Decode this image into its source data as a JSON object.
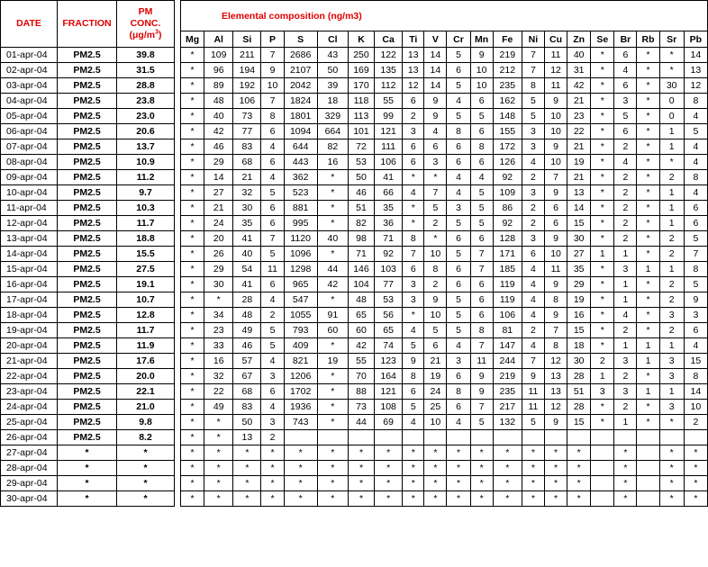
{
  "left_headers": {
    "date": "DATE",
    "fraction": "FRACTION",
    "pm_line1": "PM",
    "pm_line2": "CONC.",
    "pm_unit_pre": "(μg/m",
    "pm_unit_sup": "3",
    "pm_unit_post": ")"
  },
  "right_title": "Elemental composition (ng/m3)",
  "elements": [
    "Mg",
    "Al",
    "Si",
    "P",
    "S",
    "Cl",
    "K",
    "Ca",
    "Ti",
    "V",
    "Cr",
    "Mn",
    "Fe",
    "Ni",
    "Cu",
    "Zn",
    "Se",
    "Br",
    "Rb",
    "Sr",
    "Pb"
  ],
  "rows": [
    {
      "date": "01-apr-04",
      "fraction": "PM2.5",
      "conc": "39.8",
      "vals": [
        "*",
        "109",
        "211",
        "7",
        "2686",
        "43",
        "250",
        "122",
        "13",
        "14",
        "5",
        "9",
        "219",
        "7",
        "11",
        "40",
        "*",
        "6",
        "*",
        "*",
        "14"
      ]
    },
    {
      "date": "02-apr-04",
      "fraction": "PM2.5",
      "conc": "31.5",
      "vals": [
        "*",
        "96",
        "194",
        "9",
        "2107",
        "50",
        "169",
        "135",
        "13",
        "14",
        "6",
        "10",
        "212",
        "7",
        "12",
        "31",
        "*",
        "4",
        "*",
        "*",
        "13"
      ]
    },
    {
      "date": "03-apr-04",
      "fraction": "PM2.5",
      "conc": "28.8",
      "vals": [
        "*",
        "89",
        "192",
        "10",
        "2042",
        "39",
        "170",
        "112",
        "12",
        "14",
        "5",
        "10",
        "235",
        "8",
        "11",
        "42",
        "*",
        "6",
        "*",
        "30",
        "12"
      ]
    },
    {
      "date": "04-apr-04",
      "fraction": "PM2.5",
      "conc": "23.8",
      "vals": [
        "*",
        "48",
        "106",
        "7",
        "1824",
        "18",
        "118",
        "55",
        "6",
        "9",
        "4",
        "6",
        "162",
        "5",
        "9",
        "21",
        "*",
        "3",
        "*",
        "0",
        "8"
      ]
    },
    {
      "date": "05-apr-04",
      "fraction": "PM2.5",
      "conc": "23.0",
      "vals": [
        "*",
        "40",
        "73",
        "8",
        "1801",
        "329",
        "113",
        "99",
        "2",
        "9",
        "5",
        "5",
        "148",
        "5",
        "10",
        "23",
        "*",
        "5",
        "*",
        "0",
        "4"
      ]
    },
    {
      "date": "06-apr-04",
      "fraction": "PM2.5",
      "conc": "20.6",
      "vals": [
        "*",
        "42",
        "77",
        "6",
        "1094",
        "664",
        "101",
        "121",
        "3",
        "4",
        "8",
        "6",
        "155",
        "3",
        "10",
        "22",
        "*",
        "6",
        "*",
        "1",
        "5"
      ]
    },
    {
      "date": "07-apr-04",
      "fraction": "PM2.5",
      "conc": "13.7",
      "vals": [
        "*",
        "46",
        "83",
        "4",
        "644",
        "82",
        "72",
        "111",
        "6",
        "6",
        "6",
        "8",
        "172",
        "3",
        "9",
        "21",
        "*",
        "2",
        "*",
        "1",
        "4"
      ]
    },
    {
      "date": "08-apr-04",
      "fraction": "PM2.5",
      "conc": "10.9",
      "vals": [
        "*",
        "29",
        "68",
        "6",
        "443",
        "16",
        "53",
        "106",
        "6",
        "3",
        "6",
        "6",
        "126",
        "4",
        "10",
        "19",
        "*",
        "4",
        "*",
        "*",
        "4"
      ]
    },
    {
      "date": "09-apr-04",
      "fraction": "PM2.5",
      "conc": "11.2",
      "vals": [
        "*",
        "14",
        "21",
        "4",
        "362",
        "*",
        "50",
        "41",
        "*",
        "*",
        "4",
        "4",
        "92",
        "2",
        "7",
        "21",
        "*",
        "2",
        "*",
        "2",
        "8"
      ]
    },
    {
      "date": "10-apr-04",
      "fraction": "PM2.5",
      "conc": "9.7",
      "vals": [
        "*",
        "27",
        "32",
        "5",
        "523",
        "*",
        "46",
        "66",
        "4",
        "7",
        "4",
        "5",
        "109",
        "3",
        "9",
        "13",
        "*",
        "2",
        "*",
        "1",
        "4"
      ]
    },
    {
      "date": "11-apr-04",
      "fraction": "PM2.5",
      "conc": "10.3",
      "vals": [
        "*",
        "21",
        "30",
        "6",
        "881",
        "*",
        "51",
        "35",
        "*",
        "5",
        "3",
        "5",
        "86",
        "2",
        "6",
        "14",
        "*",
        "2",
        "*",
        "1",
        "6"
      ]
    },
    {
      "date": "12-apr-04",
      "fraction": "PM2.5",
      "conc": "11.7",
      "vals": [
        "*",
        "24",
        "35",
        "6",
        "995",
        "*",
        "82",
        "36",
        "*",
        "2",
        "5",
        "5",
        "92",
        "2",
        "6",
        "15",
        "*",
        "2",
        "*",
        "1",
        "6"
      ]
    },
    {
      "date": "13-apr-04",
      "fraction": "PM2.5",
      "conc": "18.8",
      "vals": [
        "*",
        "20",
        "41",
        "7",
        "1120",
        "40",
        "98",
        "71",
        "8",
        "*",
        "6",
        "6",
        "128",
        "3",
        "9",
        "30",
        "*",
        "2",
        "*",
        "2",
        "5"
      ]
    },
    {
      "date": "14-apr-04",
      "fraction": "PM2.5",
      "conc": "15.5",
      "vals": [
        "*",
        "26",
        "40",
        "5",
        "1096",
        "*",
        "71",
        "92",
        "7",
        "10",
        "5",
        "7",
        "171",
        "6",
        "10",
        "27",
        "1",
        "1",
        "*",
        "2",
        "7"
      ]
    },
    {
      "date": "15-apr-04",
      "fraction": "PM2.5",
      "conc": "27.5",
      "vals": [
        "*",
        "29",
        "54",
        "11",
        "1298",
        "44",
        "146",
        "103",
        "6",
        "8",
        "6",
        "7",
        "185",
        "4",
        "11",
        "35",
        "*",
        "3",
        "1",
        "1",
        "8"
      ]
    },
    {
      "date": "16-apr-04",
      "fraction": "PM2.5",
      "conc": "19.1",
      "vals": [
        "*",
        "30",
        "41",
        "6",
        "965",
        "42",
        "104",
        "77",
        "3",
        "2",
        "6",
        "6",
        "119",
        "4",
        "9",
        "29",
        "*",
        "1",
        "*",
        "2",
        "5"
      ]
    },
    {
      "date": "17-apr-04",
      "fraction": "PM2.5",
      "conc": "10.7",
      "vals": [
        "*",
        "*",
        "28",
        "4",
        "547",
        "*",
        "48",
        "53",
        "3",
        "9",
        "5",
        "6",
        "119",
        "4",
        "8",
        "19",
        "*",
        "1",
        "*",
        "2",
        "9"
      ]
    },
    {
      "date": "18-apr-04",
      "fraction": "PM2.5",
      "conc": "12.8",
      "vals": [
        "*",
        "34",
        "48",
        "2",
        "1055",
        "91",
        "65",
        "56",
        "*",
        "10",
        "5",
        "6",
        "106",
        "4",
        "9",
        "16",
        "*",
        "4",
        "*",
        "3",
        "3"
      ]
    },
    {
      "date": "19-apr-04",
      "fraction": "PM2.5",
      "conc": "11.7",
      "vals": [
        "*",
        "23",
        "49",
        "5",
        "793",
        "60",
        "60",
        "65",
        "4",
        "5",
        "5",
        "8",
        "81",
        "2",
        "7",
        "15",
        "*",
        "2",
        "*",
        "2",
        "6"
      ]
    },
    {
      "date": "20-apr-04",
      "fraction": "PM2.5",
      "conc": "11.9",
      "vals": [
        "*",
        "33",
        "46",
        "5",
        "409",
        "*",
        "42",
        "74",
        "5",
        "6",
        "4",
        "7",
        "147",
        "4",
        "8",
        "18",
        "*",
        "1",
        "1",
        "1",
        "4"
      ]
    },
    {
      "date": "21-apr-04",
      "fraction": "PM2.5",
      "conc": "17.6",
      "vals": [
        "*",
        "16",
        "57",
        "4",
        "821",
        "19",
        "55",
        "123",
        "9",
        "21",
        "3",
        "11",
        "244",
        "7",
        "12",
        "30",
        "2",
        "3",
        "1",
        "3",
        "15"
      ]
    },
    {
      "date": "22-apr-04",
      "fraction": "PM2.5",
      "conc": "20.0",
      "vals": [
        "*",
        "32",
        "67",
        "3",
        "1206",
        "*",
        "70",
        "164",
        "8",
        "19",
        "6",
        "9",
        "219",
        "9",
        "13",
        "28",
        "1",
        "2",
        "*",
        "3",
        "8"
      ]
    },
    {
      "date": "23-apr-04",
      "fraction": "PM2.5",
      "conc": "22.1",
      "vals": [
        "*",
        "22",
        "68",
        "6",
        "1702",
        "*",
        "88",
        "121",
        "6",
        "24",
        "8",
        "9",
        "235",
        "11",
        "13",
        "51",
        "3",
        "3",
        "1",
        "1",
        "14"
      ]
    },
    {
      "date": "24-apr-04",
      "fraction": "PM2.5",
      "conc": "21.0",
      "vals": [
        "*",
        "49",
        "83",
        "4",
        "1936",
        "*",
        "73",
        "108",
        "5",
        "25",
        "6",
        "7",
        "217",
        "11",
        "12",
        "28",
        "*",
        "2",
        "*",
        "3",
        "10"
      ]
    },
    {
      "date": "25-apr-04",
      "fraction": "PM2.5",
      "conc": "9.8",
      "vals": [
        "*",
        "*",
        "50",
        "3",
        "743",
        "*",
        "44",
        "69",
        "4",
        "10",
        "4",
        "5",
        "132",
        "5",
        "9",
        "15",
        "*",
        "1",
        "*",
        "*",
        "2"
      ]
    },
    {
      "date": "26-apr-04",
      "fraction": "PM2.5",
      "conc": "8.2",
      "vals": [
        "*",
        "*",
        "13",
        "2",
        "",
        "",
        "",
        "",
        "",
        "",
        "",
        "",
        "",
        "",
        "",
        "",
        "",
        "",
        "",
        "",
        ""
      ]
    },
    {
      "date": "27-apr-04",
      "fraction": "*",
      "conc": "*",
      "vals": [
        "*",
        "*",
        "*",
        "*",
        "*",
        "*",
        "*",
        "*",
        "*",
        "*",
        "*",
        "*",
        "*",
        "*",
        "*",
        "*",
        "",
        "*",
        "",
        "*",
        "*"
      ]
    },
    {
      "date": "28-apr-04",
      "fraction": "*",
      "conc": "*",
      "vals": [
        "*",
        "*",
        "*",
        "*",
        "*",
        "*",
        "*",
        "*",
        "*",
        "*",
        "*",
        "*",
        "*",
        "*",
        "*",
        "*",
        "",
        "*",
        "",
        "*",
        "*"
      ]
    },
    {
      "date": "29-apr-04",
      "fraction": "*",
      "conc": "*",
      "vals": [
        "*",
        "*",
        "*",
        "*",
        "*",
        "*",
        "*",
        "*",
        "*",
        "*",
        "*",
        "*",
        "*",
        "*",
        "*",
        "*",
        "",
        "*",
        "",
        "*",
        "*"
      ]
    },
    {
      "date": "30-apr-04",
      "fraction": "*",
      "conc": "*",
      "vals": [
        "*",
        "*",
        "*",
        "*",
        "*",
        "*",
        "*",
        "*",
        "*",
        "*",
        "*",
        "*",
        "*",
        "*",
        "*",
        "*",
        "",
        "*",
        "",
        "*",
        "*"
      ]
    }
  ]
}
